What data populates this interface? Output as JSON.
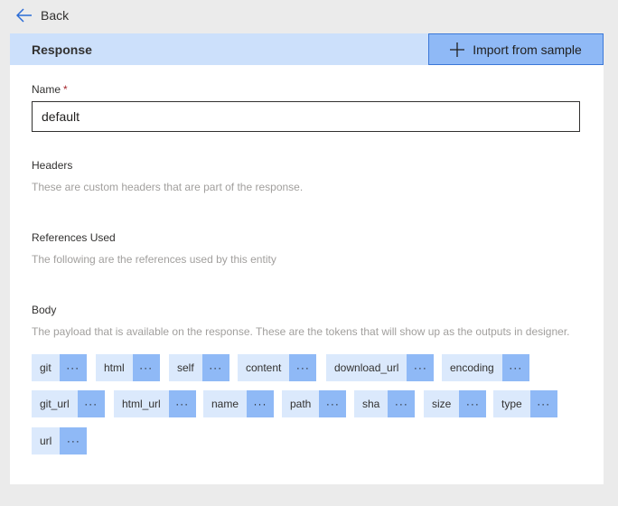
{
  "nav": {
    "back_label": "Back"
  },
  "response": {
    "title": "Response",
    "import_label": "Import from sample"
  },
  "name_field": {
    "label": "Name",
    "required_mark": "*",
    "value": "default"
  },
  "headers": {
    "label": "Headers",
    "description": "These are custom headers that are part of the response."
  },
  "references": {
    "label": "References Used",
    "description": "The following are the references used by this entity"
  },
  "body": {
    "label": "Body",
    "description": "The payload that is available on the response. These are the tokens that will show up as the outputs in designer.",
    "more_label": "···",
    "tokens": [
      "git",
      "html",
      "self",
      "content",
      "download_url",
      "encoding",
      "git_url",
      "html_url",
      "name",
      "path",
      "sha",
      "size",
      "type",
      "url"
    ]
  },
  "colors": {
    "header_band": "#cce0fb",
    "accent": "#3b78d8",
    "token_bg": "#dbe9fc",
    "token_more_bg": "#8fb9f6"
  }
}
